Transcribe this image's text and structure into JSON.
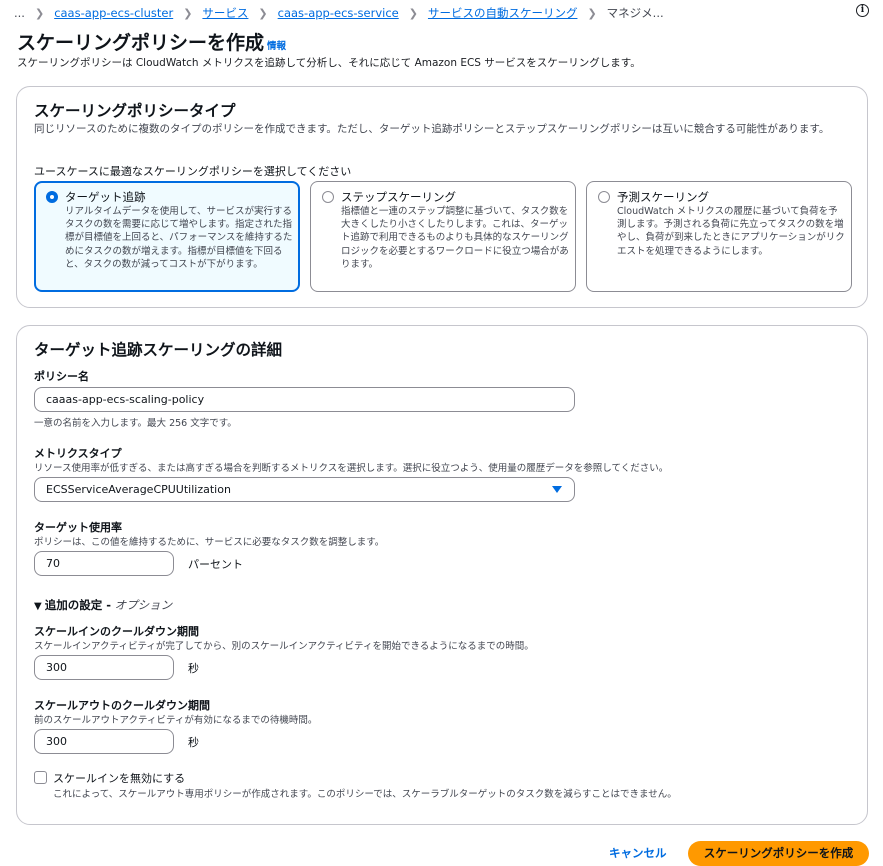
{
  "breadcrumb": {
    "ellipsis": "...",
    "items": [
      "caas-app-ecs-cluster",
      "サービス",
      "caas-app-ecs-service",
      "サービスの自動スケーリング"
    ],
    "current": "マネジメ..."
  },
  "header": {
    "title": "スケーリングポリシーを作成",
    "info_link": "情報",
    "description": "スケーリングポリシーは CloudWatch メトリクスを追跡して分析し、それに応じて Amazon ECS サービスをスケーリングします。"
  },
  "policy_type": {
    "title": "スケーリングポリシータイプ",
    "description": "同じリソースのために複数のタイプのポリシーを作成できます。ただし、ターゲット追跡ポリシーとステップスケーリングポリシーは互いに競合する可能性があります。",
    "prompt": "ユースケースに最適なスケーリングポリシーを選択してください",
    "options": [
      {
        "title": "ターゲット追跡",
        "description": "リアルタイムデータを使用して、サービスが実行するタスクの数を需要に応じて増やします。指定された指標が目標値を上回ると、パフォーマンスを維持するためにタスクの数が増えます。指標が目標値を下回ると、タスクの数が減ってコストが下がります。",
        "selected": true
      },
      {
        "title": "ステップスケーリング",
        "description": "指標値と一連のステップ調整に基づいて、タスク数を大きくしたり小さくしたりします。これは、ターゲット追跡で利用できるものよりも具体的なスケーリングロジックを必要とするワークロードに役立つ場合があります。",
        "selected": false
      },
      {
        "title": "予測スケーリング",
        "description": "CloudWatch メトリクスの履歴に基づいて負荷を予測します。予測される負荷に先立ってタスクの数を増やし、負荷が到来したときにアプリケーションがリクエストを処理できるようにします。",
        "selected": false
      }
    ]
  },
  "details": {
    "title": "ターゲット追跡スケーリングの詳細",
    "policy_name": {
      "label": "ポリシー名",
      "value": "caaas-app-ecs-scaling-policy",
      "hint": "一意の名前を入力します。最大 256 文字です。"
    },
    "metric_type": {
      "label": "メトリクスタイプ",
      "description": "リソース使用率が低すぎる、または高すぎる場合を判断するメトリクスを選択します。選択に役立つよう、使用量の履歴データを参照してください。",
      "selected": "ECSServiceAverageCPUUtilization"
    },
    "target_value": {
      "label": "ターゲット使用率",
      "description": "ポリシーは、この値を維持するために、サービスに必要なタスク数を調整します。",
      "value": "70",
      "unit": "パーセント"
    },
    "additional": {
      "label": "追加の設定 -",
      "optional": "オプション"
    },
    "scale_in_cooldown": {
      "label": "スケールインのクールダウン期間",
      "description": "スケールインアクティビティが完了してから、別のスケールインアクティビティを開始できるようになるまでの時間。",
      "value": "300",
      "unit": "秒"
    },
    "scale_out_cooldown": {
      "label": "スケールアウトのクールダウン期間",
      "description": "前のスケールアウトアクティビティが有効になるまでの待機時間。",
      "value": "300",
      "unit": "秒"
    },
    "disable_scale_in": {
      "label": "スケールインを無効にする",
      "description": "これによって、スケールアウト専用ポリシーが作成されます。このポリシーでは、スケーラブルターゲットのタスク数を減らすことはできません。",
      "checked": false
    }
  },
  "footer": {
    "cancel": "キャンセル",
    "submit": "スケーリングポリシーを作成"
  },
  "colors": {
    "accent": "#006ce0",
    "primary_button": "#ff9900",
    "selected_tile_bg": "#f0fbff",
    "border": "#c6c6cd"
  },
  "icons": {
    "info": "info-circle-icon",
    "breadcrumb_separator": "chevron-right-icon",
    "dropdown": "caret-down-icon",
    "expander": "caret-down-icon"
  }
}
